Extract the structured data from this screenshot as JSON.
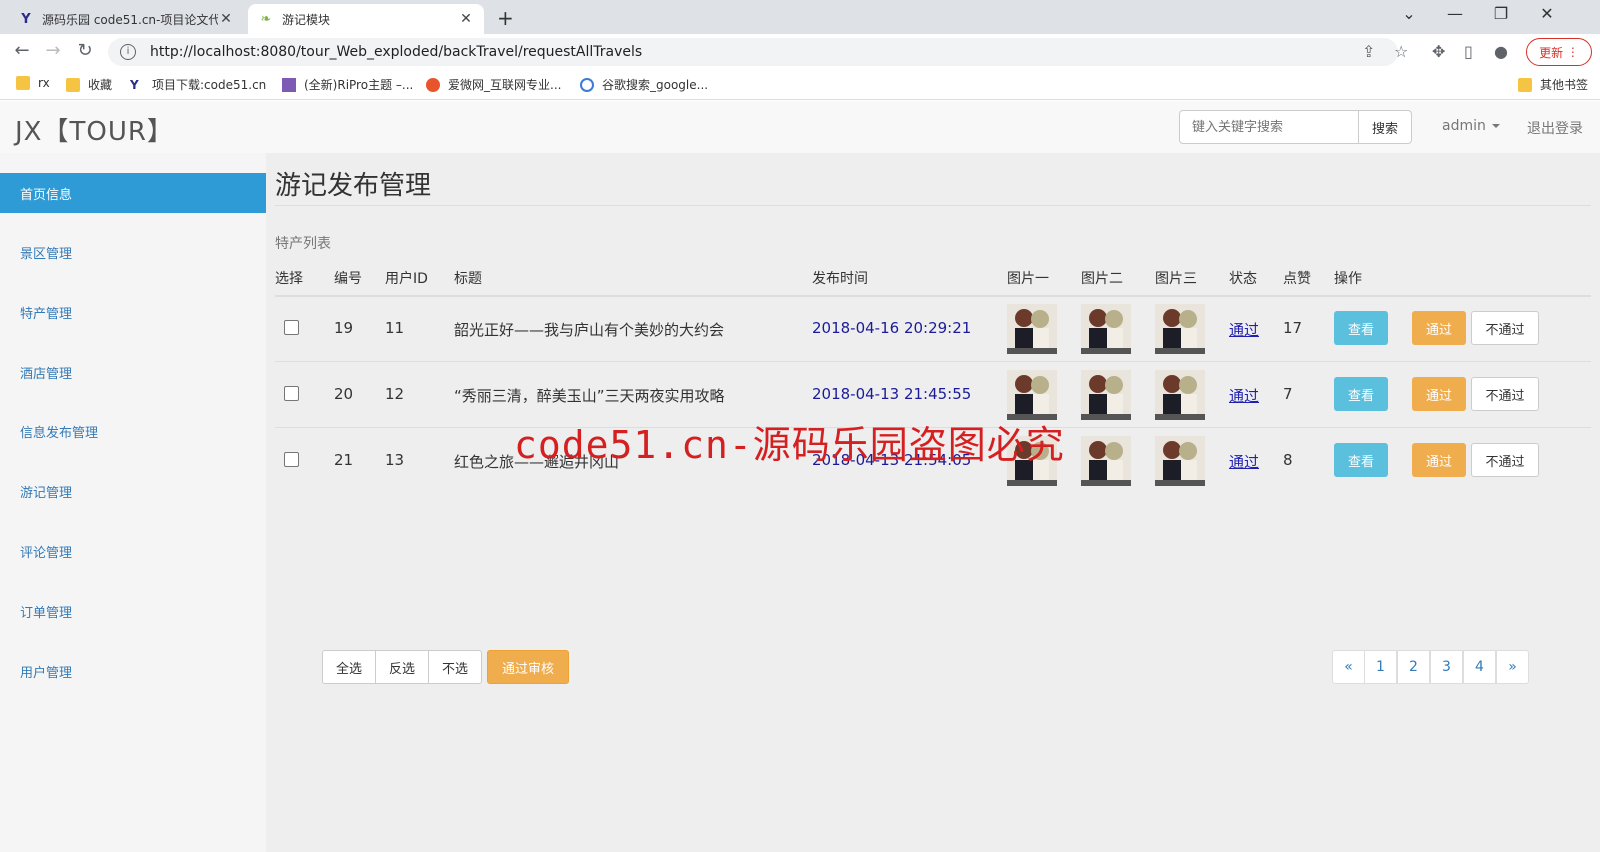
{
  "browser": {
    "tabs": [
      {
        "title": "源码乐园 code51.cn-项目论文代",
        "favicon": "Y"
      },
      {
        "title": "游记模块",
        "favicon": "leaf-icon"
      }
    ],
    "url": "http://localhost:8080/tour_Web_exploded/backTravel/requestAllTravels",
    "update_label": "更新",
    "bookmarks": [
      "rx",
      "收藏",
      "项目下载:code51.cn",
      "(全新)RiPro主题 –...",
      "爱微网_互联网专业...",
      "谷歌搜索_google..."
    ],
    "other_bookmarks": "其他书签"
  },
  "header": {
    "brand": "JX【TOUR】",
    "search_placeholder": "键入关键字搜索",
    "search_button": "搜索",
    "user": "admin",
    "logout": "退出登录"
  },
  "sidebar": {
    "items": [
      "首页信息",
      "景区管理",
      "特产管理",
      "酒店管理",
      "信息发布管理",
      "游记管理",
      "评论管理",
      "订单管理",
      "用户管理"
    ]
  },
  "main": {
    "title": "游记发布管理",
    "section_label": "特产列表",
    "columns": [
      "选择",
      "编号",
      "用户ID",
      "标题",
      "发布时间",
      "图片一",
      "图片二",
      "图片三",
      "状态",
      "点赞",
      "操作"
    ],
    "rows": [
      {
        "id": "19",
        "user_id": "11",
        "title": "韶光正好——我与庐山有个美妙的大约会",
        "time": "2018-04-16 20:29:21",
        "status": "通过",
        "likes": "17"
      },
      {
        "id": "20",
        "user_id": "12",
        "title": "“秀丽三清，醉美玉山”三天两夜实用攻略",
        "time": "2018-04-13 21:45:55",
        "status": "通过",
        "likes": "7"
      },
      {
        "id": "21",
        "user_id": "13",
        "title": "红色之旅——邂逅井冈山",
        "time": "2018-04-13 21:54:05",
        "status": "通过",
        "likes": "8"
      }
    ],
    "row_actions": {
      "view": "查看",
      "approve": "通过",
      "reject": "不通过"
    },
    "batch": {
      "select_all": "全选",
      "invert": "反选",
      "select_none": "不选",
      "approve": "通过审核"
    },
    "pagination": [
      "«",
      "1",
      "2",
      "3",
      "4",
      "»"
    ]
  },
  "watermark": "code51.cn-源码乐园盗图必究"
}
